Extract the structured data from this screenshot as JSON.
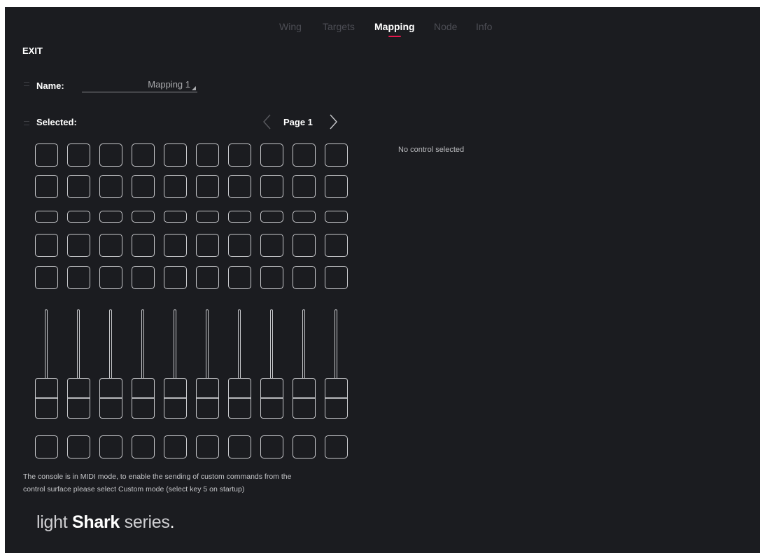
{
  "tabs": [
    {
      "label": "Wing",
      "active": false
    },
    {
      "label": "Targets",
      "active": false
    },
    {
      "label": "Mapping",
      "active": true
    },
    {
      "label": "Node",
      "active": false
    },
    {
      "label": "Info",
      "active": false
    }
  ],
  "accent_color": "#e5174d",
  "background_color": "#1b1c20",
  "exit_label": "EXIT",
  "name_row": {
    "label": "Name:",
    "value": "Mapping 1"
  },
  "selected_row": {
    "label": "Selected:"
  },
  "pager": {
    "page_label": "Page 1",
    "prev_icon": "chevron-left-icon",
    "next_icon": "chevron-right-icon"
  },
  "detail_panel": {
    "status": "No control selected"
  },
  "control_surface": {
    "columns": 10,
    "button_rows": 5,
    "fader_count": 10,
    "bottom_button_count": 10
  },
  "message": {
    "line1": "The console is in MIDI mode, to enable the sending of custom commands from the",
    "line2": "control surface please select Custom mode (select key 5 on startup)"
  },
  "logo": {
    "prefix": "light",
    "brand": "Shark",
    "suffix": "series",
    "dot": "."
  }
}
